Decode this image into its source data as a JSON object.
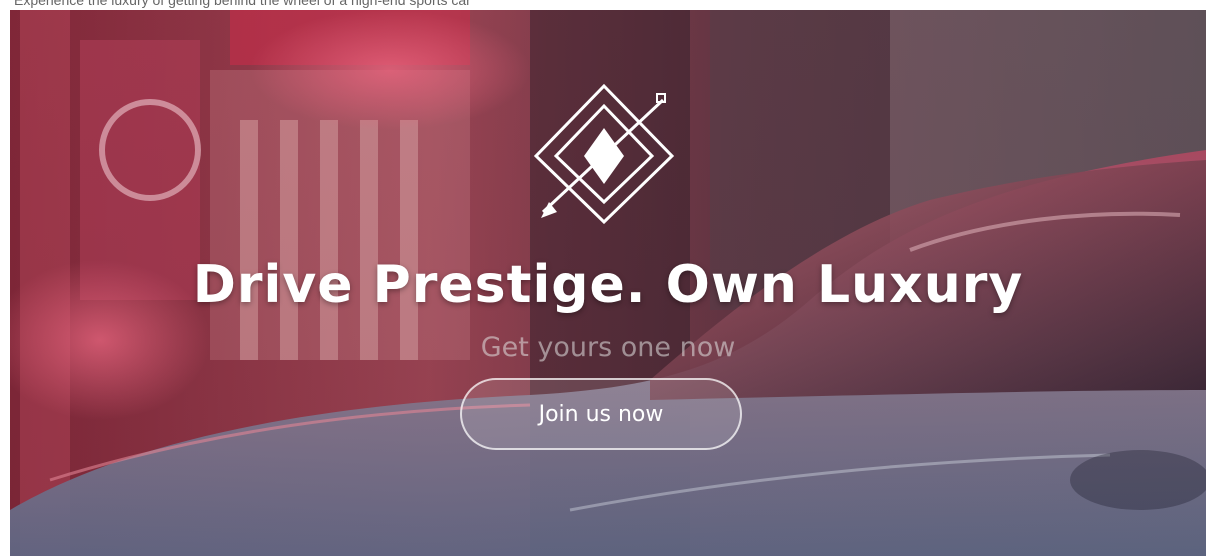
{
  "top_bar": {
    "text": "Experience the luxury of getting behind the wheel of a high-end sports car"
  },
  "hero": {
    "headline": "Drive Prestige. Own Luxury",
    "subline": "Get yours one now",
    "cta_label": "Join us now",
    "logo_icon": "diamond-arrow-logo-icon",
    "background_image": "red-neon-street-sports-car-photo"
  },
  "colors": {
    "headline": "#ffffff",
    "subline": "#e1e1e1",
    "cta_border": "#ffffff",
    "tint": "#c81e46"
  }
}
